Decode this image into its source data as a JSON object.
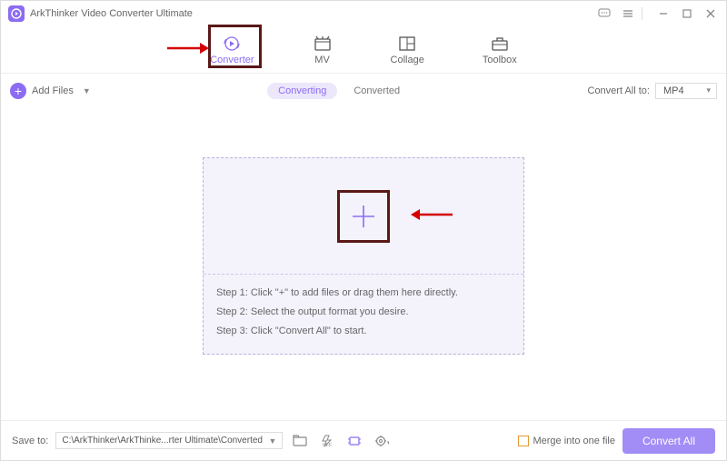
{
  "header": {
    "title": "ArkThinker Video Converter Ultimate"
  },
  "tabs": {
    "converter": "Converter",
    "mv": "MV",
    "collage": "Collage",
    "toolbox": "Toolbox"
  },
  "toolbar": {
    "add_files": "Add Files",
    "converting": "Converting",
    "converted": "Converted",
    "convert_all_to_label": "Convert All to:",
    "convert_all_to_value": "MP4"
  },
  "dropzone": {
    "step1": "Step 1: Click \"+\" to add files or drag them here directly.",
    "step2": "Step 2: Select the output format you desire.",
    "step3": "Step 3: Click \"Convert All\" to start."
  },
  "footer": {
    "save_to_label": "Save to:",
    "save_to_path": "C:\\ArkThinker\\ArkThinke...rter Ultimate\\Converted",
    "merge_label": "Merge into one file",
    "convert_all": "Convert All"
  }
}
